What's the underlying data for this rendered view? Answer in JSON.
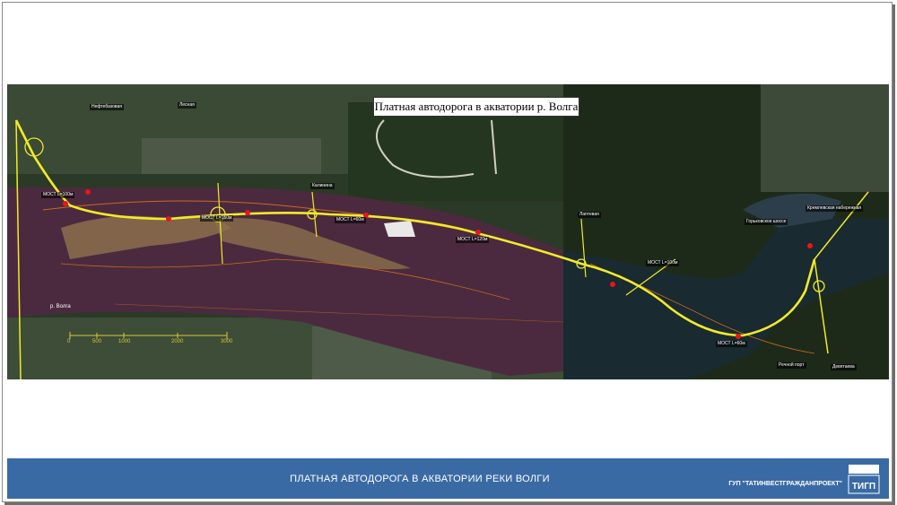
{
  "map": {
    "title": "Платная автодорога в акватории р. Волга",
    "river_label": "р. Волга",
    "scale_ticks": [
      "0",
      "500",
      "1000",
      "2000",
      "3000"
    ],
    "places": [
      {
        "id": "pl1",
        "text": "Нефтебазовая"
      },
      {
        "id": "pl2",
        "text": "Лесная"
      },
      {
        "id": "pl3",
        "text": "Калинина"
      },
      {
        "id": "pl4",
        "text": "Лаптевая"
      },
      {
        "id": "pl5",
        "text": "Горьковское шоссе"
      },
      {
        "id": "pl6",
        "text": "Кремлевская набережная"
      },
      {
        "id": "pl7",
        "text": "Речной порт"
      },
      {
        "id": "pl8",
        "text": "Девятаева"
      }
    ],
    "bridges": [
      {
        "id": "b1",
        "text": "МОСТ L=100м"
      },
      {
        "id": "b2",
        "text": "МОСТ L=150м"
      },
      {
        "id": "b3",
        "text": "МОСТ L=60м"
      },
      {
        "id": "b4",
        "text": "МОСТ L=120м"
      },
      {
        "id": "b5",
        "text": "МОСТ L=100м"
      },
      {
        "id": "b6",
        "text": "МОСТ L=60м"
      }
    ]
  },
  "footer": {
    "title": "ПЛАТНАЯ АВТОДОРОГА В АКВАТОРИИ РЕКИ ВОЛГИ",
    "org": "ГУП  \"ТАТИНВЕСТГРАЖДАНПРОЕКТ\"",
    "logo_text": "ТИГП"
  },
  "colors": {
    "footer_bg": "#3a6aa4",
    "road": "#f2ea2a",
    "water": "#4b2a3f",
    "stop": "#e8161a"
  }
}
